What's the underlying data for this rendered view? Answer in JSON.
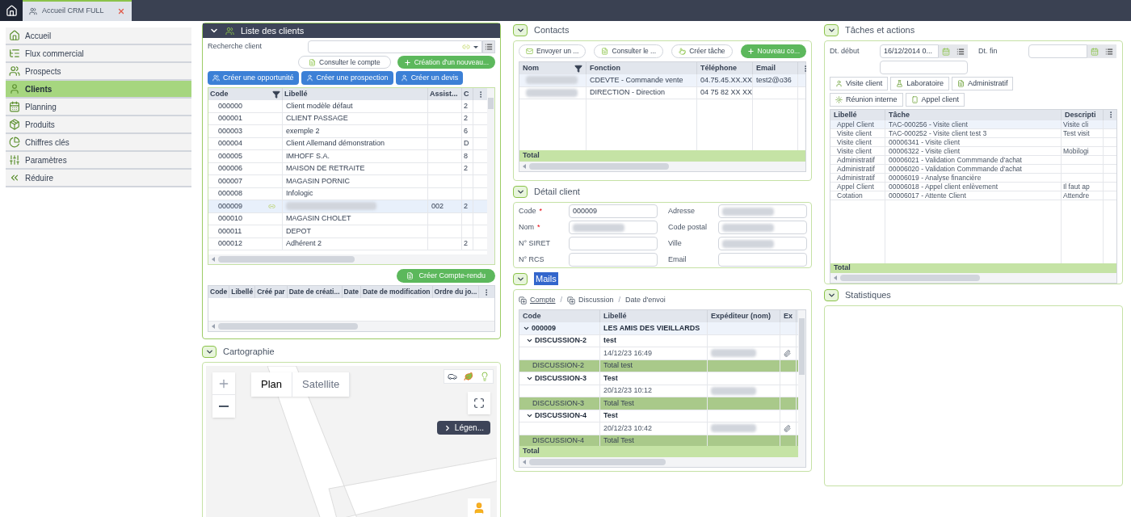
{
  "top_bar": {
    "tab": {
      "label": "Accueil CRM FULL",
      "selected": true
    }
  },
  "sidebar": {
    "items": [
      {
        "label": "Accueil",
        "selected": false
      },
      {
        "label": "Flux commercial",
        "selected": false
      },
      {
        "label": "Prospects",
        "selected": false
      },
      {
        "label": "Clients",
        "selected": true
      },
      {
        "label": "Planning",
        "selected": false
      },
      {
        "label": "Produits",
        "selected": false
      },
      {
        "label": "Chiffres clés",
        "selected": false
      },
      {
        "label": "Paramètres",
        "selected": false
      },
      {
        "label": "Réduire",
        "selected": false
      }
    ]
  },
  "clients_panel": {
    "title": "Liste des clients",
    "search_label": "Recherche client",
    "account_button": "Consulter le compte",
    "new_button": "Création d'un nouveau...",
    "actions": [
      "Créer une opportunité",
      "Créer une prospection",
      "Créer un devis"
    ],
    "table": {
      "columns": [
        "Code",
        "Libellé",
        "Assist...",
        "C"
      ],
      "rows": [
        {
          "code": "000000",
          "label": "Client modèle défaut",
          "c": "2",
          "selected": false,
          "linked": false,
          "blurred": false
        },
        {
          "code": "000001",
          "label": "CLIENT PASSAGE",
          "c": "2",
          "selected": false,
          "linked": false,
          "blurred": false
        },
        {
          "code": "000003",
          "label": "exemple 2",
          "c": "6",
          "selected": false,
          "linked": false,
          "blurred": false
        },
        {
          "code": "000004",
          "label": "Client Allemand démonstration",
          "c": "D",
          "selected": false,
          "linked": false,
          "blurred": false
        },
        {
          "code": "000005",
          "label": "IMHOFF S.A.",
          "c": "8",
          "selected": false,
          "linked": false,
          "blurred": false
        },
        {
          "code": "000006",
          "label": "MAISON DE RETRAITE",
          "c": "2",
          "selected": false,
          "linked": false,
          "blurred": false
        },
        {
          "code": "000007",
          "label": "MAGASIN PORNIC",
          "selected": false,
          "linked": false,
          "blurred": false
        },
        {
          "code": "000008",
          "label": "Infologic",
          "selected": false,
          "linked": false,
          "blurred": false
        },
        {
          "code": "000009",
          "assistant": "002",
          "c": "2",
          "selected": true,
          "linked": true,
          "blurred": true
        },
        {
          "code": "000010",
          "label": "MAGASIN CHOLET",
          "selected": false,
          "linked": false,
          "blurred": false
        },
        {
          "code": "000011",
          "label": "DEPOT",
          "selected": false,
          "linked": false,
          "blurred": false
        },
        {
          "code": "000012",
          "label": "Adhérent 2",
          "c": "2",
          "selected": false,
          "linked": false,
          "blurred": false
        }
      ]
    },
    "report_button": "Créer Compte-rendu",
    "reports_table": {
      "columns": [
        "Code",
        "Libellé",
        "Créé par",
        "Date de créati...",
        "Date",
        "Date de modification",
        "Ordre du jo..."
      ]
    }
  },
  "map_panel": {
    "title": "Cartographie",
    "map_types": [
      {
        "label": "Plan",
        "selected": true
      },
      {
        "label": "Satellite",
        "selected": false
      }
    ],
    "legend_button": "Légen..."
  },
  "contacts_panel": {
    "title": "Contacts",
    "buttons": [
      "Envoyer un ...",
      "Consulter le ...",
      "Créer tâche"
    ],
    "new_button": "Nouveau co...",
    "table": {
      "columns": [
        "Nom",
        "Fonction",
        "Téléphone",
        "Email"
      ],
      "rows": [
        {
          "function": "CDEVTE - Commande vente",
          "phone": "04.75.45.XX.XX",
          "email": "test2@o36",
          "selected": true
        },
        {
          "function": "DIRECTION - Direction",
          "phone": "04 75 82 XX XX",
          "selected": false
        }
      ],
      "footer": "Total"
    }
  },
  "detail_panel": {
    "title": "Détail client",
    "required_mark": "*",
    "left_fields": [
      {
        "label": "Code",
        "required": true,
        "value": "000009",
        "blurred": false
      },
      {
        "label": "Nom",
        "required": true,
        "blurred": true
      },
      {
        "label": "N° SIRET",
        "required": false,
        "blurred": false
      },
      {
        "label": "N° RCS",
        "required": false,
        "blurred": false
      }
    ],
    "right_fields": [
      {
        "label": "Adresse",
        "required": false,
        "blurred": true
      },
      {
        "label": "Code postal",
        "required": false,
        "blurred": true
      },
      {
        "label": "Ville",
        "required": false,
        "blurred": true
      },
      {
        "label": "Email",
        "required": false,
        "blurred": false
      }
    ]
  },
  "mails_panel": {
    "title": "Mails",
    "separator": "/",
    "breadcrumb": [
      {
        "label": "Compte",
        "kind": "link"
      },
      {
        "label": "Discussion",
        "kind": "group"
      },
      {
        "label": "Date d'envoi",
        "kind": "plain"
      }
    ],
    "columns": [
      "Code",
      "Libellé",
      "Expéditeur (nom)",
      "Ex"
    ],
    "tree": [
      {
        "code": "000009",
        "label": "LES AMIS DES VIEILLARDS",
        "expanded": true,
        "selected": true,
        "children": [
          {
            "code": "DISCUSSION-2",
            "label": "test",
            "expanded": true,
            "selected": false,
            "children": [
              {
                "label": "14/12/23 16:49",
                "attachment": true
              }
            ],
            "total": {
              "code": "DISCUSSION-2",
              "label": "Total test"
            }
          },
          {
            "code": "DISCUSSION-3",
            "label": "Test",
            "expanded": true,
            "selected": false,
            "children": [
              {
                "label": "20/12/23 10:12",
                "attachment": false
              }
            ],
            "total": {
              "code": "DISCUSSION-3",
              "label": "Total Test"
            }
          },
          {
            "code": "DISCUSSION-4",
            "label": "Test",
            "expanded": true,
            "selected": false,
            "children": [
              {
                "label": "20/12/23 10:42",
                "attachment": true
              }
            ],
            "total": {
              "code": "DISCUSSION-4",
              "label": "Total Test"
            }
          }
        ]
      }
    ],
    "footer": "Total"
  },
  "tasks_panel": {
    "title": "Tâches et actions",
    "start_label": "Dt. début",
    "start_value": "16/12/2014 0...",
    "end_label": "Dt. fin",
    "task_buttons": [
      "Visite client",
      "Laboratoire",
      "Administratif",
      "Réunion interne",
      "Appel client"
    ],
    "table": {
      "columns": [
        "Libellé",
        "Tâche",
        "Descripti"
      ],
      "rows": [
        {
          "label": "Appel Client",
          "task": "TAC-000256 - Visite client",
          "description": "Visite cli",
          "selected": true
        },
        {
          "label": "Visite client",
          "task": "TAC-000252 - Visite client test 3",
          "description": "Test visit",
          "selected": false
        },
        {
          "label": "Visite client",
          "task": "00006341 - Visite client",
          "selected": false
        },
        {
          "label": "Visite client",
          "task": "00006322 - Visite client",
          "description": "Mobilogi",
          "selected": false
        },
        {
          "label": "Administratif",
          "task": "00006021 - Validation Commmande d'achat",
          "selected": false
        },
        {
          "label": "Administratif",
          "task": "00006020 - Validation Commmande d'achat",
          "selected": false
        },
        {
          "label": "Administratif",
          "task": "00006019 - Analyse financière",
          "selected": false
        },
        {
          "label": "Appel Client",
          "task": "00006018 - Appel client enlèvement",
          "description": "Il faut ap",
          "selected": false
        },
        {
          "label": "Cotation",
          "task": "00006017 - Attente Client",
          "description": "Attendre",
          "selected": false
        }
      ],
      "footer": "Total"
    }
  },
  "stats_panel": {
    "title": "Statistiques"
  }
}
